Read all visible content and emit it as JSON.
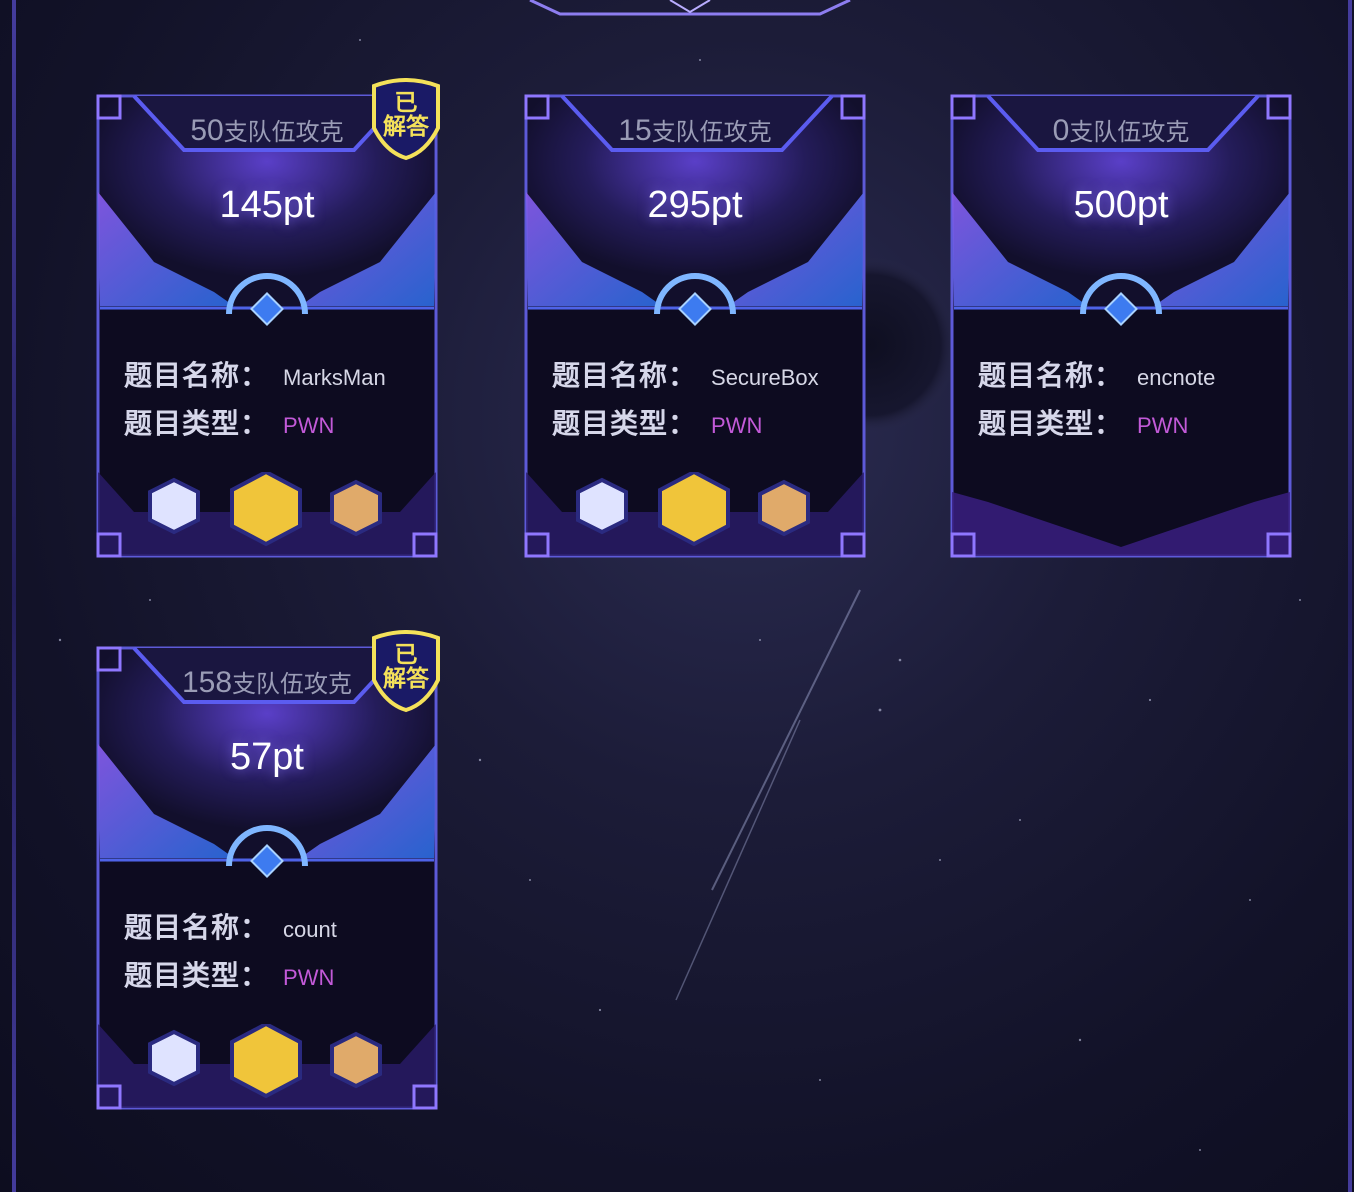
{
  "challenges": [
    {
      "team_count": "50",
      "team_suffix": "支队伍攻克",
      "points": "145pt",
      "name_label": "题目名称：",
      "name": "MarksMan",
      "type_label": "题目类型：",
      "type": "PWN",
      "solved": true,
      "solved_line1": "已",
      "solved_line2": "解答",
      "bloods": [
        "gem-white",
        "gem-gold",
        "gem-bronze"
      ]
    },
    {
      "team_count": "15",
      "team_suffix": "支队伍攻克",
      "points": "295pt",
      "name_label": "题目名称：",
      "name": "SecureBox",
      "type_label": "题目类型：",
      "type": "PWN",
      "solved": false,
      "bloods": [
        "gem-white",
        "gem-gold",
        "gem-bronze"
      ]
    },
    {
      "team_count": "0",
      "team_suffix": "支队伍攻克",
      "points": "500pt",
      "name_label": "题目名称：",
      "name": "encnote",
      "type_label": "题目类型：",
      "type": "PWN",
      "solved": false,
      "bloods": []
    },
    {
      "team_count": "158",
      "team_suffix": "支队伍攻克",
      "points": "57pt",
      "name_label": "题目名称：",
      "name": "count",
      "type_label": "题目类型：",
      "type": "PWN",
      "solved": true,
      "solved_line1": "已",
      "solved_line2": "解答",
      "bloods": [
        "gem-white",
        "gem-gold",
        "gem-bronze"
      ]
    }
  ],
  "colors": {
    "accent": "#6f5bff",
    "type_text": "#c25ad8",
    "badge_yellow": "#f4e15a",
    "badge_bg": "#1a1a66"
  }
}
